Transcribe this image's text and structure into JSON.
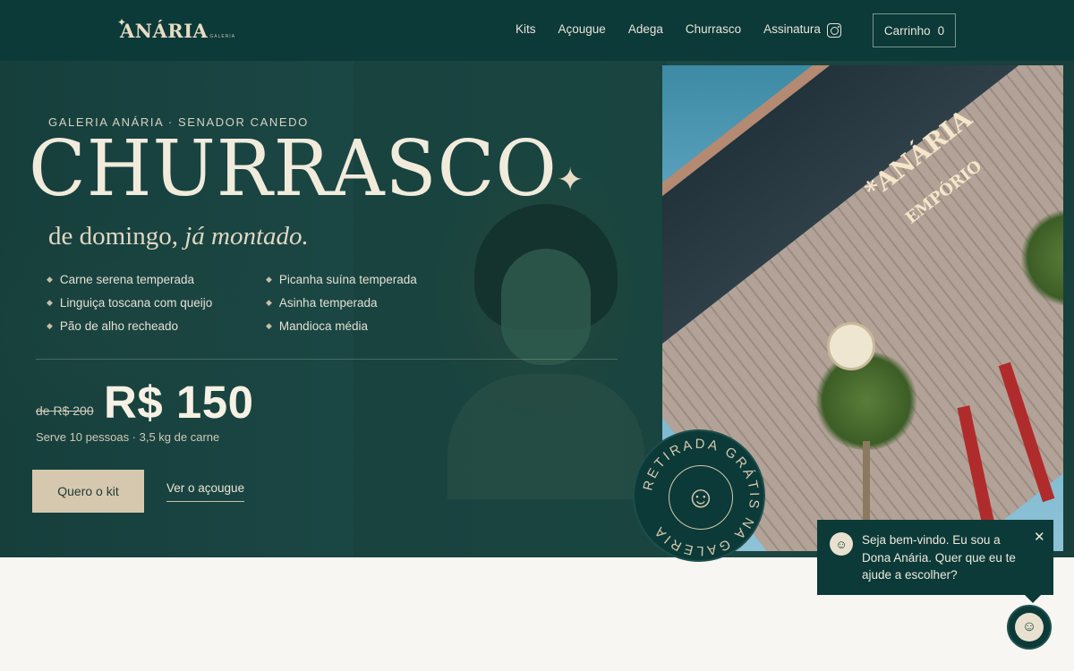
{
  "header": {
    "logo_text": "ANÁRIA",
    "logo_sub": "GALERIA",
    "menu": [
      "Kits",
      "Açougue",
      "Adega",
      "Churrasco",
      "Assinatura"
    ],
    "instagram_icon": "instagram-icon",
    "cart_label": "Carrinho",
    "cart_count": "0"
  },
  "hero": {
    "eyebrow": "GALERIA ANÁRIA · SENADOR CANEDO",
    "title": "CHURRASCO",
    "subtitle_plain": "de domingo,",
    "subtitle_italic": "já montado.",
    "items": [
      "Carne serena temperada",
      "Picanha suína temperada",
      "Linguiça toscana com queijo",
      "Asinha temperada",
      "Pão de alho recheado",
      "Mandioca média"
    ],
    "old_price": "de R$ 200",
    "price": "R$ 150",
    "serves": "Serve 10 pessoas · 3,5 kg de carne",
    "cta_primary": "Quero o kit",
    "cta_secondary": "Ver o açougue"
  },
  "photo": {
    "sign_main": "*ANÁRIA",
    "sign_sub": "EMPÓRIO"
  },
  "badge": {
    "text": "RETIRADA GRÁTIS NA GALERIA"
  },
  "chat": {
    "message": "Seja bem-vindo. Eu sou a Dona Anária. Quer que eu te ajude a escolher?",
    "close_icon": "close-icon"
  },
  "colors": {
    "nav_bg": "#0b3a38",
    "accent": "#d6c8ae",
    "page_bg": "#f7f6f2"
  }
}
